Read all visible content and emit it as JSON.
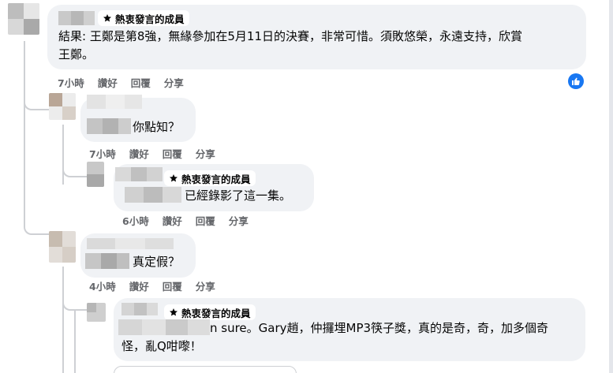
{
  "badge": {
    "label": "熱衷發言的成員"
  },
  "actions": {
    "like": "讚好",
    "reply": "回覆",
    "share": "分享"
  },
  "comments": [
    {
      "text_line1": "結果: 王鄭是第8強，無緣參加在5月11日的決賽，非常可惜。須敗悠榮，永遠支持，欣賞",
      "text_line2": "王鄭。",
      "time": "7小時",
      "reaction": "like-reaction-icon"
    },
    {
      "text": "你點知？",
      "time": "7小時"
    },
    {
      "text": "已經錄影了這一集。",
      "time": "6小時"
    },
    {
      "text": "真定假？",
      "time": "4小時"
    },
    {
      "text_line1": "n sure。Gary趙，仲攞埋MP3筷子獎，真的是奇，奇，加多個奇",
      "text_line2": "怪，亂Q咁嚟！"
    }
  ],
  "colors": {
    "bubble": "#f0f2f5",
    "meta": "#65676b",
    "thread_line": "#ced0d4",
    "like_blue": "#1877f2"
  }
}
